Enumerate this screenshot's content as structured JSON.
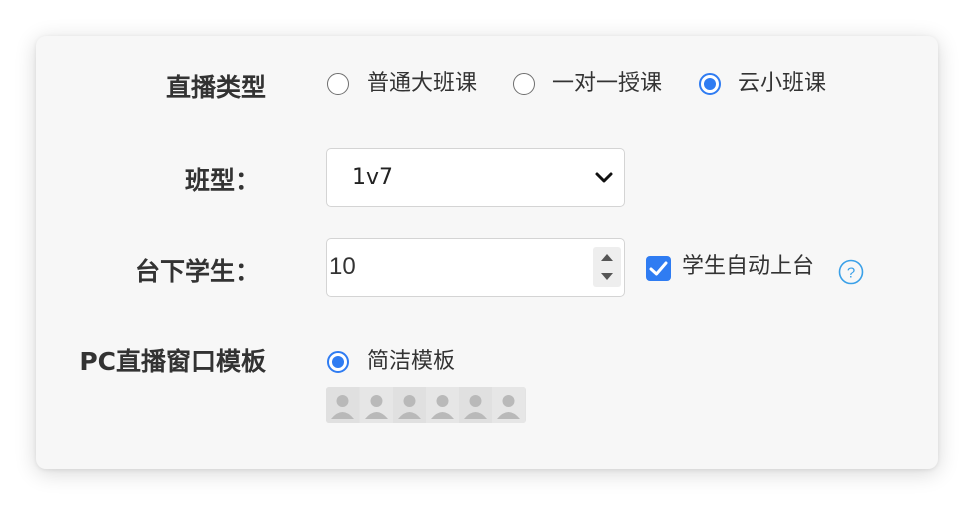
{
  "form": {
    "live_type": {
      "label": "直播类型",
      "options": [
        {
          "label": "普通大班课",
          "selected": false
        },
        {
          "label": "一对一授课",
          "selected": false
        },
        {
          "label": "云小班课",
          "selected": true
        }
      ]
    },
    "class_type": {
      "label": "班型：",
      "selected_value": "1v7",
      "icon": "chevron-down-icon"
    },
    "audience_students": {
      "label": "台下学生：",
      "value": "10",
      "auto_stage_checkbox": {
        "label": "学生自动上台",
        "checked": true
      },
      "help_icon": "question-circle-icon"
    },
    "pc_template": {
      "label": "PC直播窗口模板",
      "option": {
        "label": "简洁模板",
        "selected": true
      },
      "preview_avatar_count": 6
    }
  },
  "colors": {
    "accent": "#2f7cf2",
    "help": "#3aa0e8",
    "card_background": "#f7f7f7",
    "label_text": "#333333"
  }
}
